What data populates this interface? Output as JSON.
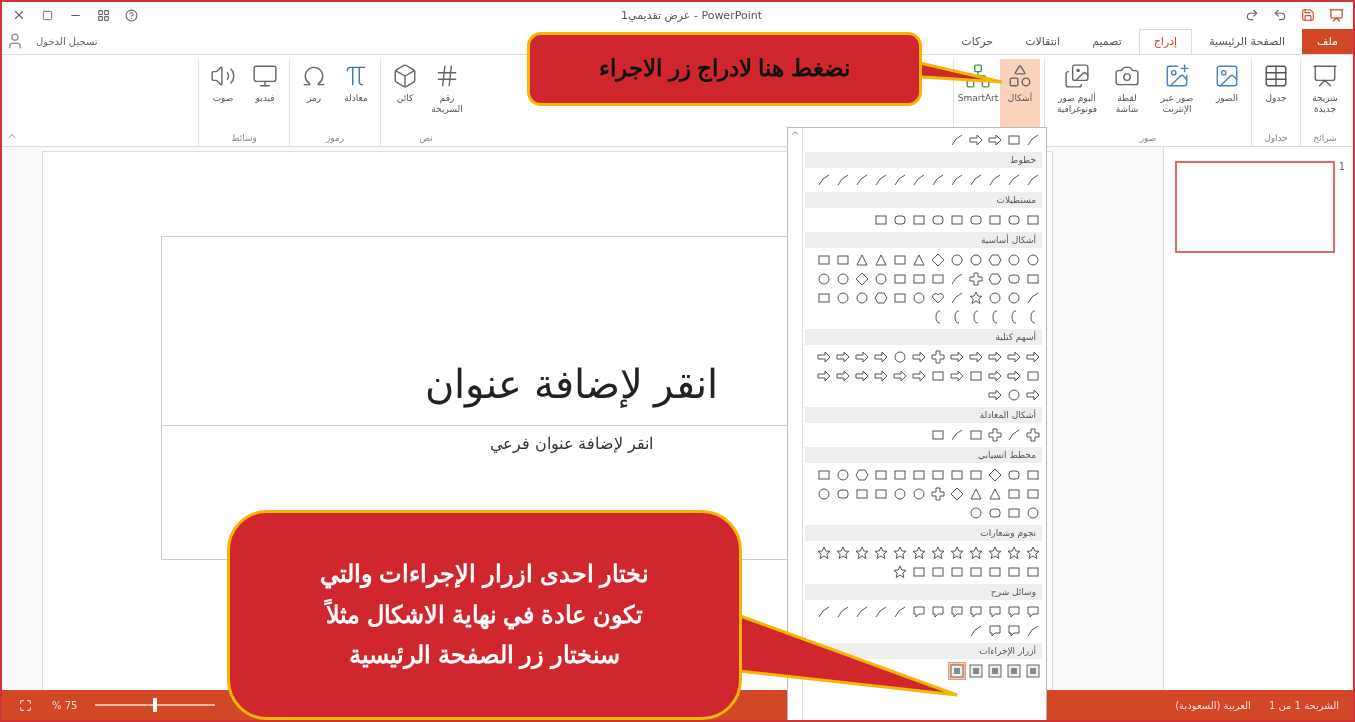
{
  "title_bar": {
    "title": "PowerPoint - عرض تقديمي1"
  },
  "tabs": [
    {
      "label": "ملف",
      "selected": false,
      "kind": "file"
    },
    {
      "label": "الصفحة الرئيسية",
      "selected": false,
      "kind": "tab"
    },
    {
      "label": "إدراج",
      "selected": true,
      "kind": "tab"
    },
    {
      "label": "تصميم",
      "selected": false,
      "kind": "tab"
    },
    {
      "label": "انتقالات",
      "selected": false,
      "kind": "tab"
    },
    {
      "label": "حركات",
      "selected": false,
      "kind": "tab"
    }
  ],
  "sign_in": "تسجيل الدخول",
  "ribbon_right": [
    {
      "label": "شرائح",
      "buttons": [
        {
          "label": "شريحة جديدة",
          "kind": "slide",
          "selected": false
        }
      ]
    },
    {
      "label": "جداول",
      "buttons": [
        {
          "label": "جدول",
          "kind": "table",
          "selected": false
        }
      ]
    },
    {
      "label": "صور",
      "buttons": [
        {
          "label": "الصور",
          "kind": "picture",
          "selected": false
        },
        {
          "label": "صور عبر الإنترنت",
          "kind": "online",
          "selected": false
        },
        {
          "label": "لقطة شاشة",
          "kind": "screenshot",
          "selected": false
        },
        {
          "label": "ألبوم صور فوتوغرافية",
          "kind": "album",
          "selected": false
        }
      ]
    },
    {
      "buttons": [
        {
          "label": "أشكال",
          "kind": "shapes",
          "selected": true
        },
        {
          "label": "SmartArt",
          "kind": "smartart",
          "selected": false
        }
      ]
    }
  ],
  "ribbon_left": [
    {
      "label": "نص",
      "buttons": [
        {
          "label": "رقم الشريحة",
          "kind": "number",
          "selected": false
        },
        {
          "label": "كائن",
          "kind": "object",
          "selected": false
        }
      ]
    },
    {
      "label": "رموز",
      "buttons": [
        {
          "label": "معادلة",
          "kind": "equation",
          "selected": false
        },
        {
          "label": "رمز",
          "kind": "symbol",
          "selected": false
        }
      ]
    },
    {
      "label": "وسائط",
      "buttons": [
        {
          "label": "فيديو",
          "kind": "video",
          "selected": false
        },
        {
          "label": "صوت",
          "kind": "audio",
          "selected": false
        }
      ]
    }
  ],
  "slide": {
    "title_placeholder": "انقر لإضافة عنوان",
    "subtitle_placeholder": "انقر لإضافة عنوان فرعي"
  },
  "thumbnails": [
    {
      "number": "1",
      "selected": true
    }
  ],
  "shapes_gallery": [
    {
      "shapes": [
        {
          "kind": "line"
        },
        {
          "kind": "rect"
        },
        {
          "kind": "arrow"
        },
        {
          "kind": "arrow"
        },
        {
          "kind": "line"
        }
      ]
    },
    {
      "label": "خطوط",
      "shapes": [
        {
          "kind": "line"
        },
        {
          "kind": "line"
        },
        {
          "kind": "line"
        },
        {
          "kind": "line"
        },
        {
          "kind": "line"
        },
        {
          "kind": "line"
        },
        {
          "kind": "line"
        },
        {
          "kind": "line"
        },
        {
          "kind": "line"
        },
        {
          "kind": "line"
        },
        {
          "kind": "line"
        },
        {
          "kind": "line"
        }
      ]
    },
    {
      "label": "مستطيلات",
      "shapes": [
        {
          "kind": "rect"
        },
        {
          "kind": "rounded"
        },
        {
          "kind": "rect"
        },
        {
          "kind": "rounded"
        },
        {
          "kind": "rect"
        },
        {
          "kind": "rounded"
        },
        {
          "kind": "rect"
        },
        {
          "kind": "rounded"
        },
        {
          "kind": "rect"
        }
      ]
    },
    {
      "label": "أشكال أساسية",
      "shapes": [
        {
          "kind": "oval"
        },
        {
          "kind": "oval"
        },
        {
          "kind": "hexagon"
        },
        {
          "kind": "oval"
        },
        {
          "kind": "oval"
        },
        {
          "kind": "diamond"
        },
        {
          "kind": "triangle"
        },
        {
          "kind": "rect"
        },
        {
          "kind": "triangle"
        },
        {
          "kind": "triangle"
        },
        {
          "kind": "rect"
        },
        {
          "kind": "rect"
        },
        {
          "kind": "rect"
        },
        {
          "kind": "rounded"
        },
        {
          "kind": "hexagon"
        },
        {
          "kind": "cross"
        },
        {
          "kind": "line"
        },
        {
          "kind": "rect"
        },
        {
          "kind": "rect"
        },
        {
          "kind": "rect"
        },
        {
          "kind": "oval"
        },
        {
          "kind": "diamond"
        },
        {
          "kind": "oval"
        },
        {
          "kind": "oval"
        },
        {
          "kind": "line"
        },
        {
          "kind": "oval"
        },
        {
          "kind": "oval"
        },
        {
          "kind": "star"
        },
        {
          "kind": "line"
        },
        {
          "kind": "heart"
        },
        {
          "kind": "oval"
        },
        {
          "kind": "rect"
        },
        {
          "kind": "hexagon"
        },
        {
          "kind": "oval"
        },
        {
          "kind": "oval"
        },
        {
          "kind": "rect"
        },
        {
          "kind": "bracket"
        },
        {
          "kind": "bracket"
        },
        {
          "kind": "bracket"
        },
        {
          "kind": "bracket"
        },
        {
          "kind": "bracket"
        },
        {
          "kind": "bracket"
        }
      ]
    },
    {
      "label": "أسهم كتلية",
      "shapes": [
        {
          "kind": "arrow"
        },
        {
          "kind": "arrow"
        },
        {
          "kind": "arrow"
        },
        {
          "kind": "arrow"
        },
        {
          "kind": "arrow"
        },
        {
          "kind": "cross"
        },
        {
          "kind": "arrow"
        },
        {
          "kind": "oval"
        },
        {
          "kind": "arrow"
        },
        {
          "kind": "arrow"
        },
        {
          "kind": "arrow"
        },
        {
          "kind": "arrow"
        },
        {
          "kind": "rect"
        },
        {
          "kind": "arrow"
        },
        {
          "kind": "arrow"
        },
        {
          "kind": "rect"
        },
        {
          "kind": "arrow"
        },
        {
          "kind": "rect"
        },
        {
          "kind": "arrow"
        },
        {
          "kind": "arrow"
        },
        {
          "kind": "arrow"
        },
        {
          "kind": "arrow"
        },
        {
          "kind": "arrow"
        },
        {
          "kind": "arrow"
        },
        {
          "kind": "arrow"
        },
        {
          "kind": "oval"
        },
        {
          "kind": "arrow"
        }
      ]
    },
    {
      "label": "أشكال المعادلة",
      "shapes": [
        {
          "kind": "cross"
        },
        {
          "kind": "line"
        },
        {
          "kind": "cross"
        },
        {
          "kind": "rect"
        },
        {
          "kind": "line"
        },
        {
          "kind": "rect"
        }
      ]
    },
    {
      "label": "مخطط انسيابي",
      "shapes": [
        {
          "kind": "rect"
        },
        {
          "kind": "rounded"
        },
        {
          "kind": "diamond"
        },
        {
          "kind": "rect"
        },
        {
          "kind": "rect"
        },
        {
          "kind": "rect"
        },
        {
          "kind": "rect"
        },
        {
          "kind": "rect"
        },
        {
          "kind": "rect"
        },
        {
          "kind": "hexagon"
        },
        {
          "kind": "oval"
        },
        {
          "kind": "rect"
        },
        {
          "kind": "rect"
        },
        {
          "kind": "rect"
        },
        {
          "kind": "triangle"
        },
        {
          "kind": "triangle"
        },
        {
          "kind": "diamond"
        },
        {
          "kind": "cross"
        },
        {
          "kind": "oval"
        },
        {
          "kind": "oval"
        },
        {
          "kind": "rect"
        },
        {
          "kind": "rect"
        },
        {
          "kind": "rounded"
        },
        {
          "kind": "oval"
        },
        {
          "kind": "oval"
        },
        {
          "kind": "rect"
        },
        {
          "kind": "rounded"
        },
        {
          "kind": "oval"
        }
      ]
    },
    {
      "label": "نجوم وشعارات",
      "shapes": [
        {
          "kind": "star"
        },
        {
          "kind": "star"
        },
        {
          "kind": "star"
        },
        {
          "kind": "star"
        },
        {
          "kind": "star"
        },
        {
          "kind": "star"
        },
        {
          "kind": "star"
        },
        {
          "kind": "star"
        },
        {
          "kind": "star"
        },
        {
          "kind": "star"
        },
        {
          "kind": "star"
        },
        {
          "kind": "star"
        },
        {
          "kind": "rect"
        },
        {
          "kind": "rect"
        },
        {
          "kind": "rect"
        },
        {
          "kind": "rect"
        },
        {
          "kind": "rect"
        },
        {
          "kind": "rect"
        },
        {
          "kind": "rect"
        },
        {
          "kind": "star"
        }
      ]
    },
    {
      "label": "وسائل شرح",
      "shapes": [
        {
          "kind": "callout"
        },
        {
          "kind": "callout"
        },
        {
          "kind": "callout"
        },
        {
          "kind": "callout"
        },
        {
          "kind": "callout"
        },
        {
          "kind": "callout"
        },
        {
          "kind": "callout"
        },
        {
          "kind": "line"
        },
        {
          "kind": "line"
        },
        {
          "kind": "line"
        },
        {
          "kind": "line"
        },
        {
          "kind": "line"
        },
        {
          "kind": "line"
        },
        {
          "kind": "callout"
        },
        {
          "kind": "callout"
        },
        {
          "kind": "line"
        }
      ]
    },
    {
      "label": "أزرار الإجراءات",
      "shapes": [
        {
          "kind": "action",
          "selected": false
        },
        {
          "kind": "action",
          "selected": false
        },
        {
          "kind": "action",
          "selected": false
        },
        {
          "kind": "action",
          "selected": false
        },
        {
          "kind": "action",
          "selected": true
        }
      ]
    }
  ],
  "status_bar": {
    "slide_counter": "الشريحة 1 من 1",
    "language": "العربية (السعودية)",
    "zoom": "75 %",
    "zoom_slider": {
      "level": 0.5
    }
  },
  "callouts": [
    {
      "text": "نضغط هنا لادراج زر الاجراء",
      "kind": "top"
    },
    {
      "text": "نختار احدى ازرار الإجراءات والتي\nتكون عادة في نهاية الاشكال مثلاً\nسنختار زر الصفحة الرئيسية",
      "kind": "bottom"
    }
  ]
}
